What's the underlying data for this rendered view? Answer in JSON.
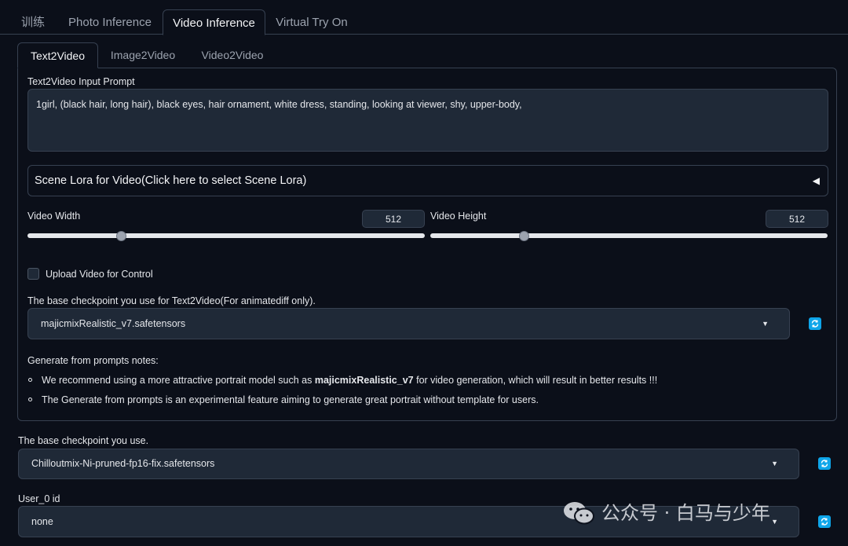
{
  "main_tabs": [
    "训练",
    "Photo Inference",
    "Video Inference",
    "Virtual Try On"
  ],
  "sub_tabs": [
    "Text2Video",
    "Image2Video",
    "Video2Video"
  ],
  "prompt": {
    "label": "Text2Video Input Prompt",
    "value": "1girl, (black hair, long hair), black eyes, hair ornament, white dress, standing, looking at viewer, shy, upper-body,"
  },
  "scene_lora": {
    "label": "Scene Lora for Video(Click here to select Scene Lora)",
    "arrow": "◀"
  },
  "video_width": {
    "label": "Video Width",
    "value": "512",
    "level": 0.23
  },
  "video_height": {
    "label": "Video Height",
    "value": "512",
    "level": 0.23
  },
  "upload_control": {
    "label": "Upload Video for Control",
    "checked": false
  },
  "t2v_checkpoint": {
    "label": "The base checkpoint you use for Text2Video(For animatediff only).",
    "value": "majicmixRealistic_v7.safetensors"
  },
  "notes": {
    "title": "Generate from prompts notes:",
    "item1_prefix": "We recommend using a more attractive portrait model such as ",
    "item1_bold": "majicmixRealistic_v7",
    "item1_suffix": " for video generation, which will result in better results !!!",
    "item2": "The Generate from prompts is an experimental feature aiming to generate great portrait without template for users."
  },
  "base_checkpoint": {
    "label": "The base checkpoint you use.",
    "value": "Chilloutmix-Ni-pruned-fp16-fix.safetensors"
  },
  "user_id": {
    "label": "User_0 id",
    "value": "none"
  },
  "watermark": {
    "text": "公众号 · 白马与少年"
  },
  "colors": {
    "background": "#0b0f19",
    "input": "#1f2937",
    "border": "#374151",
    "accent": "#0ea5e9"
  }
}
